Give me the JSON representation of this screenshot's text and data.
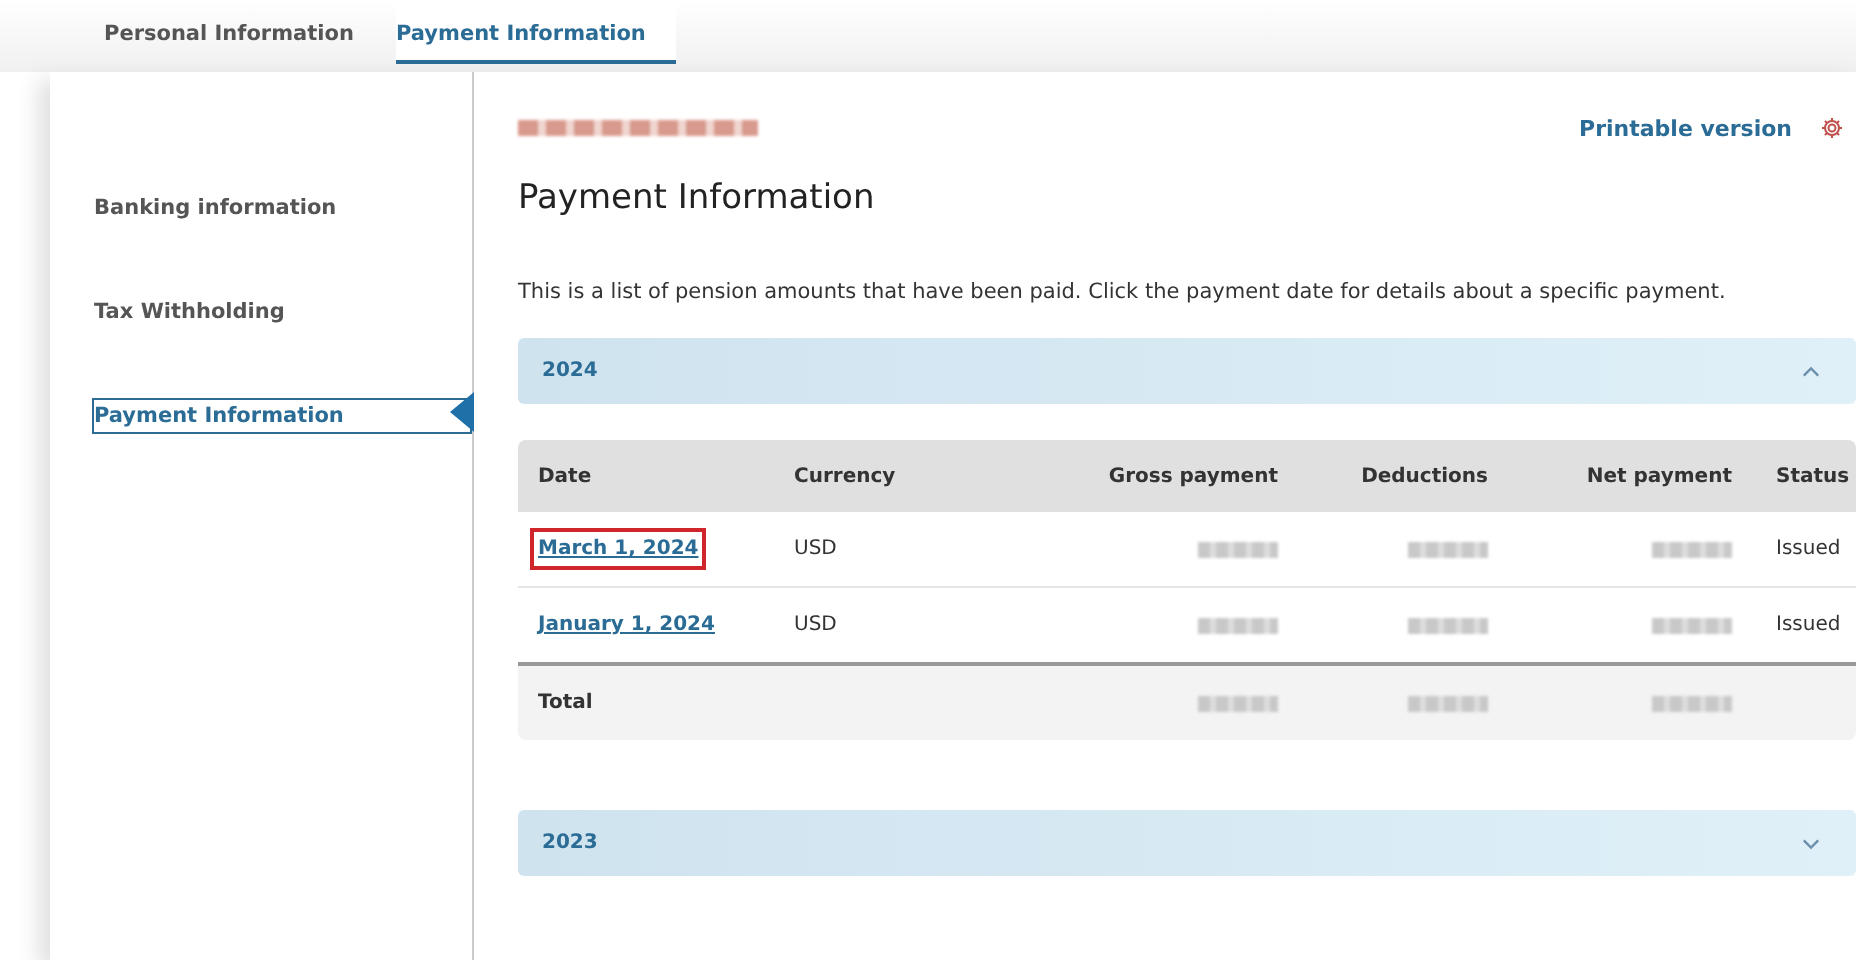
{
  "tabs": [
    {
      "label": "Personal Information",
      "selected": false
    },
    {
      "label": "Payment Information",
      "selected": true
    }
  ],
  "sidebar": {
    "items": [
      {
        "label": "Banking information",
        "selected": false
      },
      {
        "label": "Tax Withholding",
        "selected": false
      },
      {
        "label": "Payment Information",
        "selected": true
      }
    ]
  },
  "header": {
    "account_name": {
      "redacted": true
    },
    "printable_link": "Printable version"
  },
  "title": "Payment Information",
  "intro": "This is a list of pension amounts that have been paid. Click the payment date for details about a specific payment.",
  "years": [
    {
      "label": "2024",
      "expanded": true,
      "table": {
        "columns": [
          "Date",
          "Currency",
          "Gross payment",
          "Deductions",
          "Net payment",
          "Status"
        ],
        "rows": [
          {
            "date": "March 1, 2024",
            "highlighted": true,
            "currency": "USD",
            "gross": {
              "redacted": true
            },
            "deductions": {
              "redacted": true
            },
            "net": {
              "redacted": true
            },
            "status": "Issued"
          },
          {
            "date": "January 1, 2024",
            "highlighted": false,
            "currency": "USD",
            "gross": {
              "redacted": true
            },
            "deductions": {
              "redacted": true
            },
            "net": {
              "redacted": true
            },
            "status": "Issued"
          }
        ],
        "total": {
          "label": "Total",
          "gross": {
            "redacted": true
          },
          "deductions": {
            "redacted": true
          },
          "net": {
            "redacted": true
          }
        }
      }
    },
    {
      "label": "2023",
      "expanded": false
    }
  ]
}
